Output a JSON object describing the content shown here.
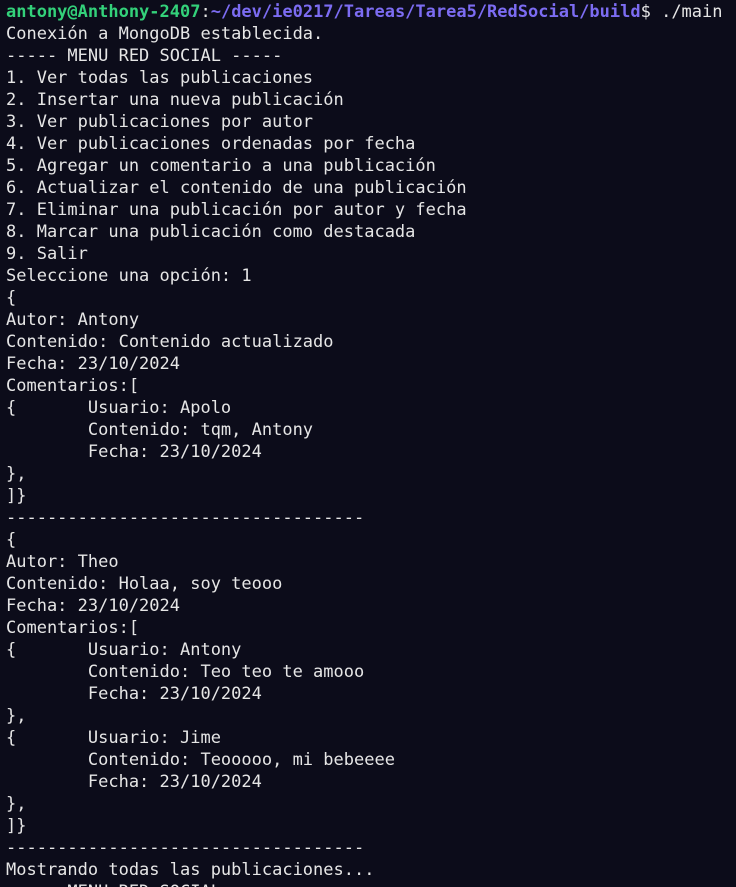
{
  "prompt": {
    "user_host": "antony@Anthony-2407",
    "separator": ":",
    "path": "~/dev/ie0217/Tareas/Tarea5/RedSocial/build",
    "symbol": "$",
    "command": " ./main"
  },
  "colors": {
    "background": "#0c0c1a",
    "text": "#e6e6e6",
    "user_host": "#33d17a",
    "path": "#7c6cf2"
  },
  "output": [
    "Conexión a MongoDB establecida.",
    "----- MENU RED SOCIAL -----",
    "1. Ver todas las publicaciones",
    "2. Insertar una nueva publicación",
    "3. Ver publicaciones por autor",
    "4. Ver publicaciones ordenadas por fecha",
    "5. Agregar un comentario a una publicación",
    "6. Actualizar el contenido de una publicación",
    "7. Eliminar una publicación por autor y fecha",
    "8. Marcar una publicación como destacada",
    "9. Salir",
    "Seleccione una opción: 1",
    "{",
    "Autor: Antony",
    "Contenido: Contenido actualizado",
    "Fecha: 23/10/2024",
    "Comentarios:[",
    "{       Usuario: Apolo",
    "        Contenido: tqm, Antony",
    "        Fecha: 23/10/2024",
    "},",
    "]}",
    "-----------------------------------",
    "{",
    "Autor: Theo",
    "Contenido: Holaa, soy teooo",
    "Fecha: 23/10/2024",
    "Comentarios:[",
    "{       Usuario: Antony",
    "        Contenido: Teo teo te amooo",
    "        Fecha: 23/10/2024",
    "},",
    "{       Usuario: Jime",
    "        Contenido: Teooooo, mi bebeeee",
    "        Fecha: 23/10/2024",
    "},",
    "]}",
    "-----------------------------------",
    "Mostrando todas las publicaciones...",
    "----- MENU RED SOCIAL -----"
  ]
}
